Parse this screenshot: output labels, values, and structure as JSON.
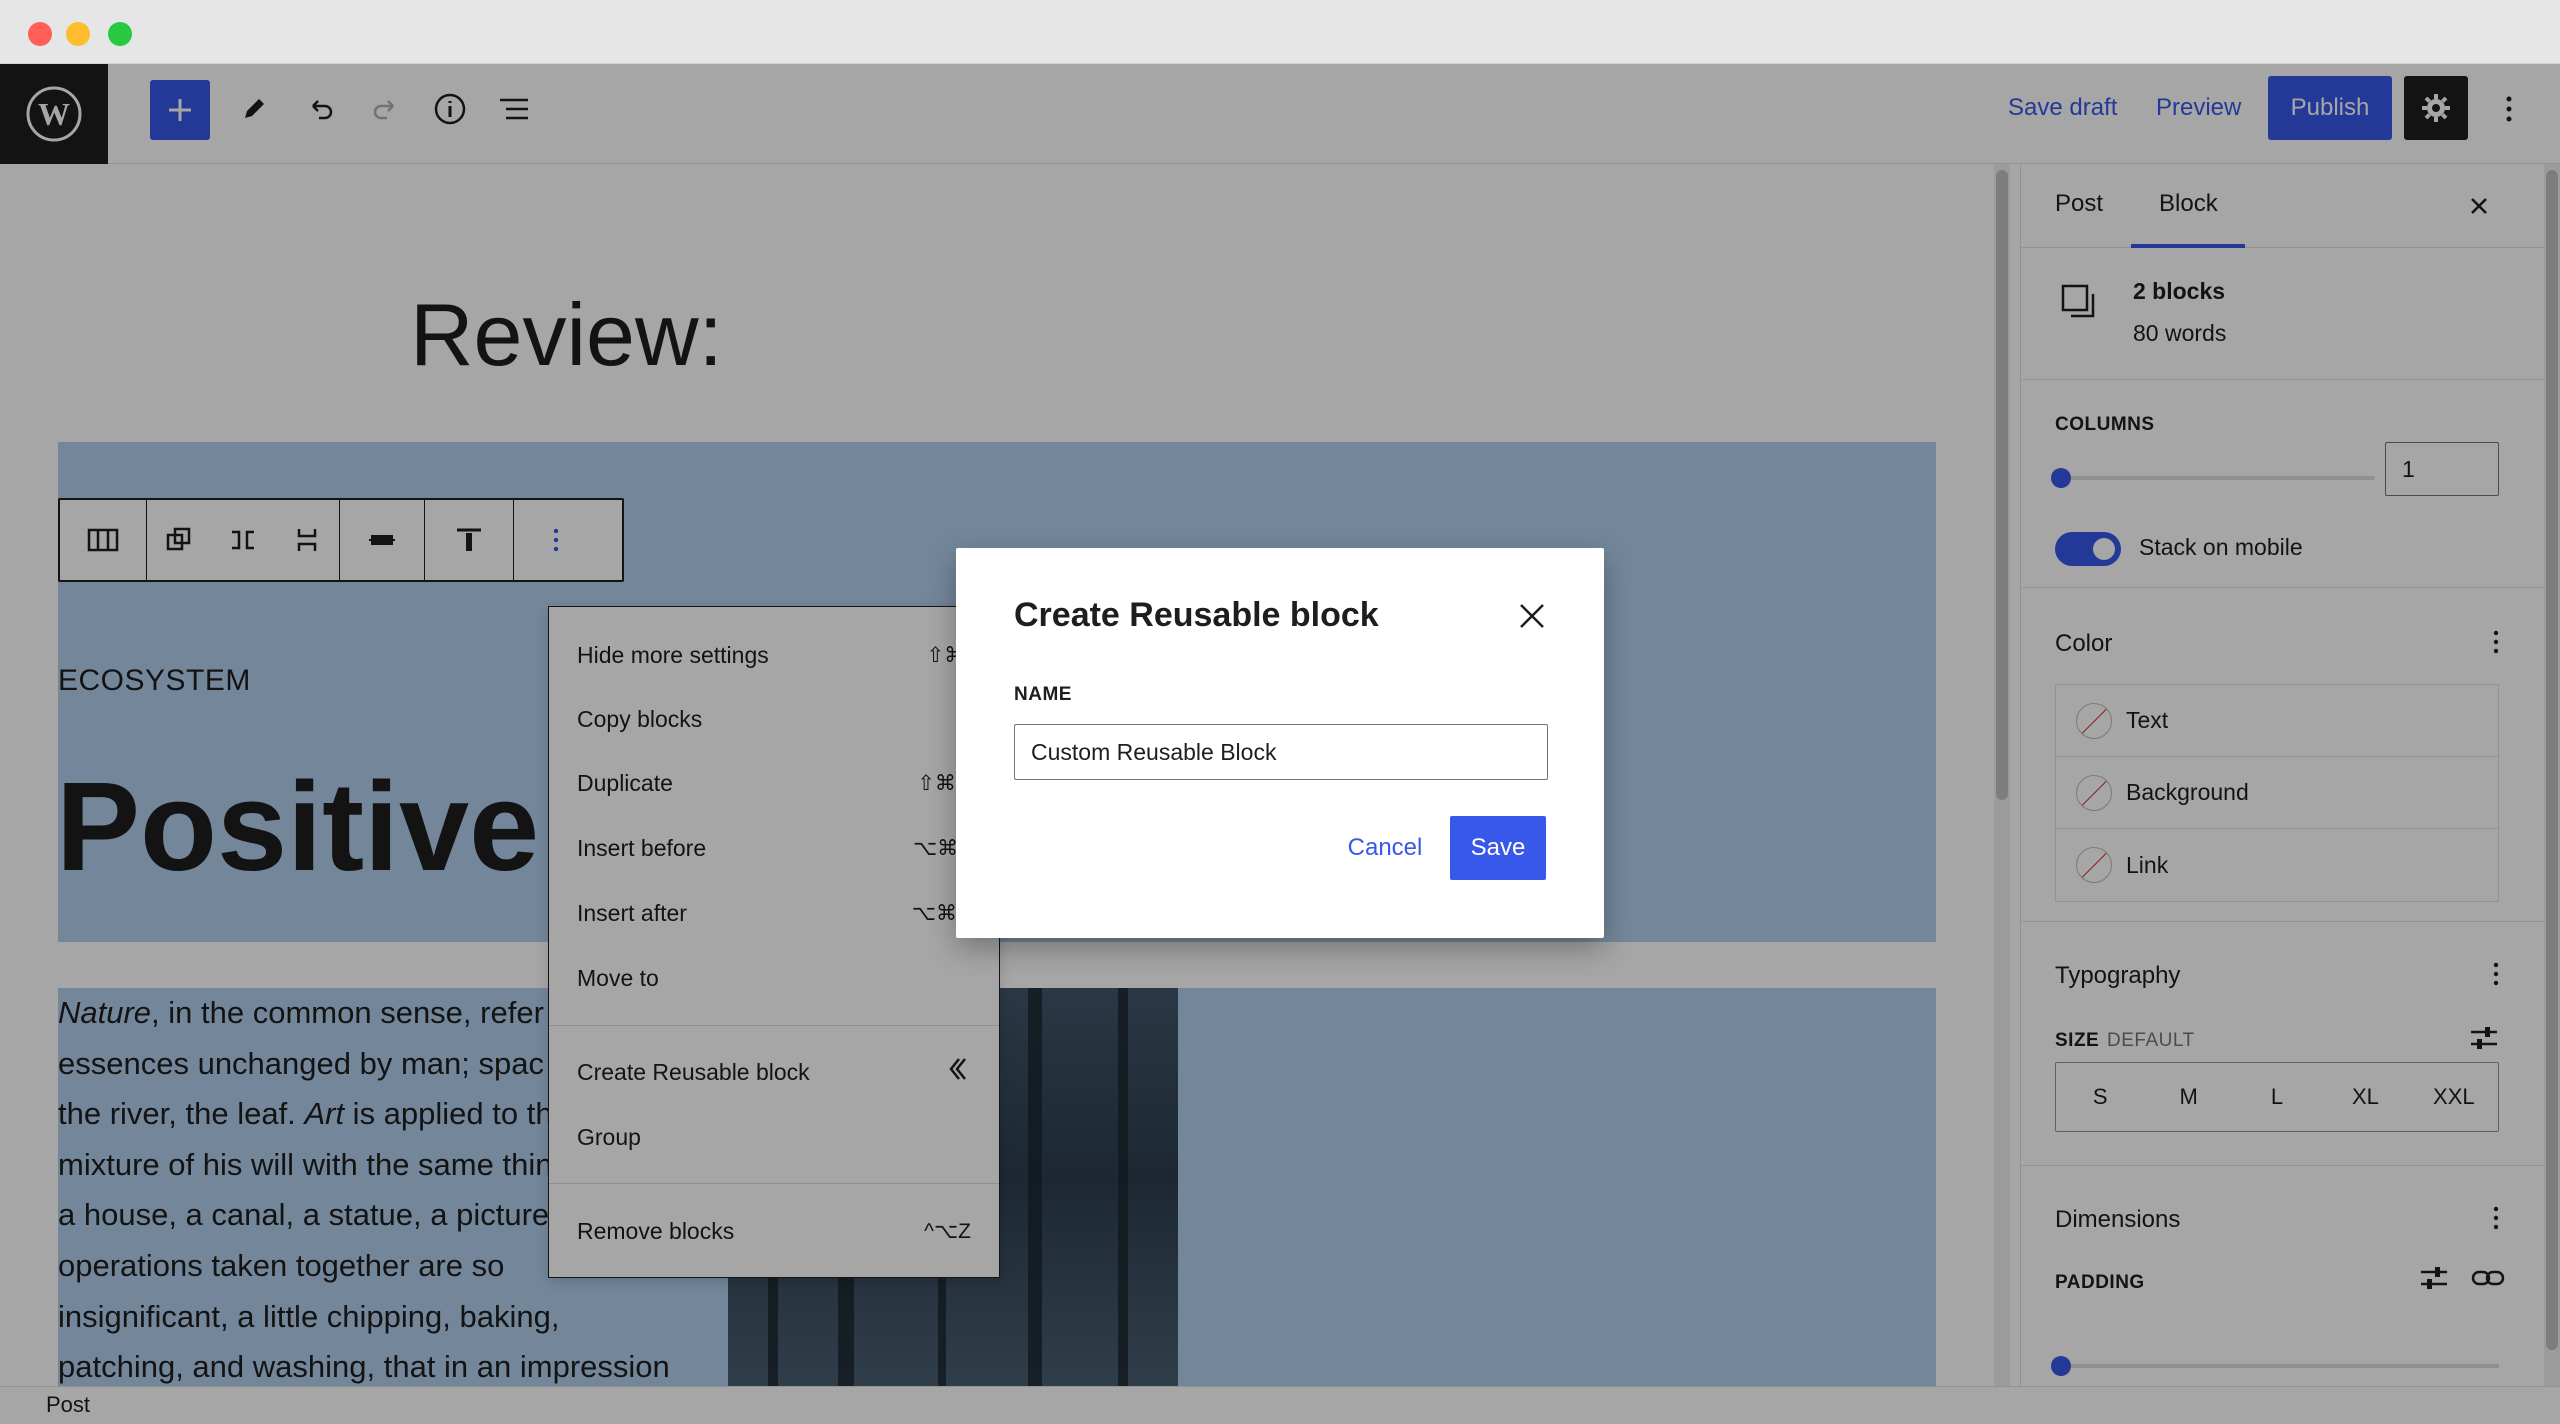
{
  "window": {
    "controls": [
      "close",
      "minimize",
      "maximize"
    ]
  },
  "header": {
    "logo_icon": "wordpress-icon",
    "toolbar_icons": [
      "plus-icon",
      "pencil-icon",
      "undo-icon",
      "redo-icon",
      "info-icon",
      "list-view-icon"
    ],
    "save_draft": "Save draft",
    "preview": "Preview",
    "publish": "Publish",
    "settings_icon": "gear-icon",
    "more_icon": "more-vertical-icon"
  },
  "editor": {
    "title": "Review:",
    "eyebrow": "ECOSYSTEM",
    "headline": "Positive g",
    "body_html_parts": [
      [
        "Nature",
        true
      ],
      [
        ", in the common sense, refer",
        false
      ]
    ],
    "body_lines": [
      "essences unchanged by man; spac",
      "the river, the leaf.",
      "mixture of his will with the same things, as in",
      "a house, a canal, a statue, a picture. But his",
      "operations taken together are so",
      "insignificant, a little chipping, baking,",
      "patching, and washing, that in an impression"
    ],
    "art_word": "Art",
    "art_rest": " is applied to the"
  },
  "block_toolbar": {
    "icons": [
      "columns-icon",
      "duplicate-blocks-icon",
      "move-horizontal-icon",
      "move-vertical-icon",
      "align-center-icon",
      "align-top-icon",
      "more-vertical-icon"
    ]
  },
  "context_menu": {
    "items": [
      {
        "label": "Hide more settings",
        "shortcut": "⇧⌘,"
      },
      {
        "label": "Copy blocks",
        "shortcut": ""
      },
      {
        "label": "Duplicate",
        "shortcut": "⇧⌘D"
      },
      {
        "label": "Insert before",
        "shortcut": "⌥⌘T"
      },
      {
        "label": "Insert after",
        "shortcut": "⌥⌘Y"
      },
      {
        "label": "Move to",
        "shortcut": ""
      }
    ],
    "items2": [
      {
        "label": "Create Reusable block",
        "icon": "reusable-block-icon"
      },
      {
        "label": "Group",
        "shortcut": ""
      }
    ],
    "items3": [
      {
        "label": "Remove blocks",
        "shortcut": "^⌥Z"
      }
    ]
  },
  "sidebar": {
    "tabs": [
      "Post",
      "Block"
    ],
    "active_tab": "Block",
    "summary": {
      "title": "2 blocks",
      "subtitle": "80 words"
    },
    "columns_label": "COLUMNS",
    "columns_value": "1",
    "stack_label": "Stack on mobile",
    "stack_on": true,
    "color_heading": "Color",
    "color_items": [
      "Text",
      "Background",
      "Link"
    ],
    "typography_heading": "Typography",
    "size_label": "SIZE",
    "size_value": "DEFAULT",
    "sizes": [
      "S",
      "M",
      "L",
      "XL",
      "XXL"
    ],
    "dimensions_heading": "Dimensions",
    "padding_label": "PADDING"
  },
  "footer": {
    "breadcrumb": "Post"
  },
  "modal": {
    "title": "Create Reusable block",
    "name_label": "NAME",
    "name_value": "Custom Reusable Block",
    "cancel": "Cancel",
    "save": "Save"
  },
  "colors": {
    "accent": "#3858e9",
    "cover_bg": "#b2cfed",
    "dark": "#1e1e1e"
  }
}
